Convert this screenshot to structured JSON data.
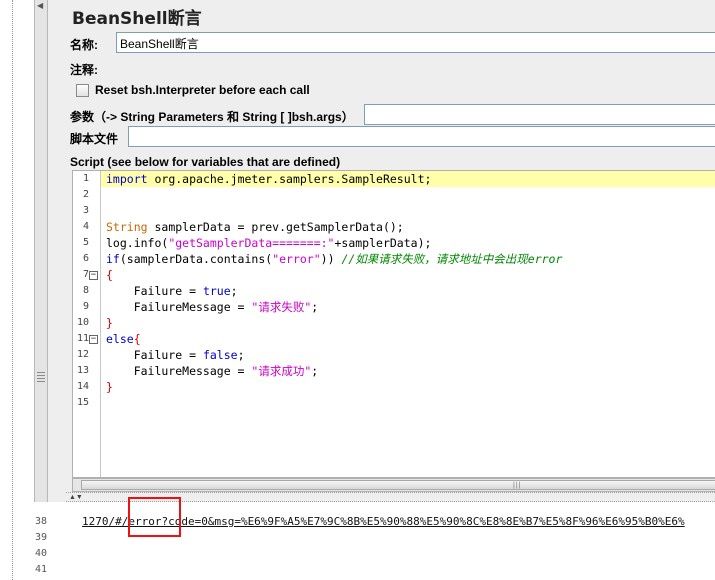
{
  "title": "BeanShell断言",
  "fields": {
    "name_label": "名称:",
    "name_value": "BeanShell断言",
    "comment_label": "注释:",
    "reset_label": "Reset bsh.Interpreter before each call",
    "params_label": "参数（-> String Parameters 和 String [ ]bsh.args）",
    "script_file_label": "脚本文件",
    "script_label": "Script (see below for variables that are defined)"
  },
  "editor": {
    "line_numbers": [
      "1",
      "2",
      "3",
      "4",
      "5",
      "6",
      "7",
      "8",
      "9",
      "10",
      "11",
      "12",
      "13",
      "14",
      "15"
    ],
    "lines": [
      "import org.apache.jmeter.samplers.SampleResult;",
      "",
      "",
      "String samplerData = prev.getSamplerData();",
      "log.info(\"getSamplerData=======:\"+samplerData);",
      "if(samplerData.contains(\"error\")) //如果请求失败，请求地址中会出现error",
      "{",
      "    Failure = true;",
      "    FailureMessage = \"请求失败\";",
      "}",
      "else{",
      "    Failure = false;",
      "    FailureMessage = \"请求成功\";",
      "}",
      ""
    ]
  },
  "output": {
    "line_numbers": [
      "38",
      "39",
      "40",
      "41"
    ],
    "line38": "1270/#/error?code=0&msg=%E6%9F%A5%E7%9C%8B%E5%90%88%E5%90%8C%E8%8E%B7%E5%8F%96%E6%95%B0%E6%"
  },
  "colors": {
    "current_line": "#ffffaa",
    "keyword": "#0000cc",
    "string": "#cc00cc",
    "comment": "#008800",
    "highlight_box": "#ee1111"
  }
}
